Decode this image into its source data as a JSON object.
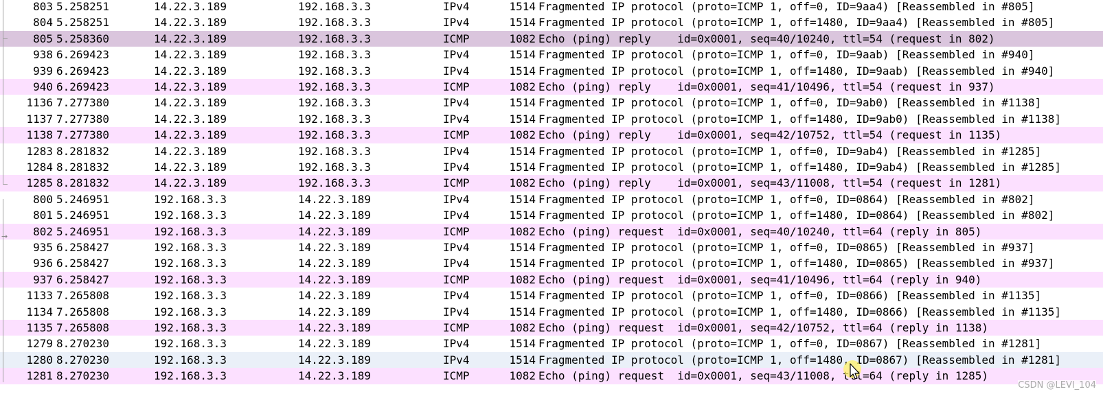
{
  "packet_list": {
    "rows": [
      {
        "no": "803",
        "time": "5.258251",
        "src": "14.22.3.189",
        "dst": "192.168.3.3",
        "proto": "IPv4",
        "len": "1514",
        "info": "Fragmented IP protocol (proto=ICMP 1, off=0, ID=9aa4) [Reassembled in #805]",
        "style": "ipv4"
      },
      {
        "no": "804",
        "time": "5.258251",
        "src": "14.22.3.189",
        "dst": "192.168.3.3",
        "proto": "IPv4",
        "len": "1514",
        "info": "Fragmented IP protocol (proto=ICMP 1, off=1480, ID=9aa4) [Reassembled in #805]",
        "style": "ipv4"
      },
      {
        "no": "805",
        "time": "5.258360",
        "src": "14.22.3.189",
        "dst": "192.168.3.3",
        "proto": "ICMP",
        "len": "1082",
        "info": "Echo (ping) reply    id=0x0001, seq=40/10240, ttl=54 (request in 802)",
        "style": "selected"
      },
      {
        "no": "938",
        "time": "6.269423",
        "src": "14.22.3.189",
        "dst": "192.168.3.3",
        "proto": "IPv4",
        "len": "1514",
        "info": "Fragmented IP protocol (proto=ICMP 1, off=0, ID=9aab) [Reassembled in #940]",
        "style": "ipv4"
      },
      {
        "no": "939",
        "time": "6.269423",
        "src": "14.22.3.189",
        "dst": "192.168.3.3",
        "proto": "IPv4",
        "len": "1514",
        "info": "Fragmented IP protocol (proto=ICMP 1, off=1480, ID=9aab) [Reassembled in #940]",
        "style": "ipv4"
      },
      {
        "no": "940",
        "time": "6.269423",
        "src": "14.22.3.189",
        "dst": "192.168.3.3",
        "proto": "ICMP",
        "len": "1082",
        "info": "Echo (ping) reply    id=0x0001, seq=41/10496, ttl=54 (request in 937)",
        "style": "icmp"
      },
      {
        "no": "1136",
        "time": "7.277380",
        "src": "14.22.3.189",
        "dst": "192.168.3.3",
        "proto": "IPv4",
        "len": "1514",
        "info": "Fragmented IP protocol (proto=ICMP 1, off=0, ID=9ab0) [Reassembled in #1138]",
        "style": "ipv4"
      },
      {
        "no": "1137",
        "time": "7.277380",
        "src": "14.22.3.189",
        "dst": "192.168.3.3",
        "proto": "IPv4",
        "len": "1514",
        "info": "Fragmented IP protocol (proto=ICMP 1, off=1480, ID=9ab0) [Reassembled in #1138]",
        "style": "ipv4"
      },
      {
        "no": "1138",
        "time": "7.277380",
        "src": "14.22.3.189",
        "dst": "192.168.3.3",
        "proto": "ICMP",
        "len": "1082",
        "info": "Echo (ping) reply    id=0x0001, seq=42/10752, ttl=54 (request in 1135)",
        "style": "icmp"
      },
      {
        "no": "1283",
        "time": "8.281832",
        "src": "14.22.3.189",
        "dst": "192.168.3.3",
        "proto": "IPv4",
        "len": "1514",
        "info": "Fragmented IP protocol (proto=ICMP 1, off=0, ID=9ab4) [Reassembled in #1285]",
        "style": "ipv4"
      },
      {
        "no": "1284",
        "time": "8.281832",
        "src": "14.22.3.189",
        "dst": "192.168.3.3",
        "proto": "IPv4",
        "len": "1514",
        "info": "Fragmented IP protocol (proto=ICMP 1, off=1480, ID=9ab4) [Reassembled in #1285]",
        "style": "ipv4"
      },
      {
        "no": "1285",
        "time": "8.281832",
        "src": "14.22.3.189",
        "dst": "192.168.3.3",
        "proto": "ICMP",
        "len": "1082",
        "info": "Echo (ping) reply    id=0x0001, seq=43/11008, ttl=54 (request in 1281)",
        "style": "icmp"
      },
      {
        "no": "800",
        "time": "5.246951",
        "src": "192.168.3.3",
        "dst": "14.22.3.189",
        "proto": "IPv4",
        "len": "1514",
        "info": "Fragmented IP protocol (proto=ICMP 1, off=0, ID=0864) [Reassembled in #802]",
        "style": "ipv4"
      },
      {
        "no": "801",
        "time": "5.246951",
        "src": "192.168.3.3",
        "dst": "14.22.3.189",
        "proto": "IPv4",
        "len": "1514",
        "info": "Fragmented IP protocol (proto=ICMP 1, off=1480, ID=0864) [Reassembled in #802]",
        "style": "ipv4"
      },
      {
        "no": "802",
        "time": "5.246951",
        "src": "192.168.3.3",
        "dst": "14.22.3.189",
        "proto": "ICMP",
        "len": "1082",
        "info": "Echo (ping) request  id=0x0001, seq=40/10240, ttl=64 (reply in 805)",
        "style": "icmp"
      },
      {
        "no": "935",
        "time": "6.258427",
        "src": "192.168.3.3",
        "dst": "14.22.3.189",
        "proto": "IPv4",
        "len": "1514",
        "info": "Fragmented IP protocol (proto=ICMP 1, off=0, ID=0865) [Reassembled in #937]",
        "style": "ipv4"
      },
      {
        "no": "936",
        "time": "6.258427",
        "src": "192.168.3.3",
        "dst": "14.22.3.189",
        "proto": "IPv4",
        "len": "1514",
        "info": "Fragmented IP protocol (proto=ICMP 1, off=1480, ID=0865) [Reassembled in #937]",
        "style": "ipv4"
      },
      {
        "no": "937",
        "time": "6.258427",
        "src": "192.168.3.3",
        "dst": "14.22.3.189",
        "proto": "ICMP",
        "len": "1082",
        "info": "Echo (ping) request  id=0x0001, seq=41/10496, ttl=64 (reply in 940)",
        "style": "icmp"
      },
      {
        "no": "1133",
        "time": "7.265808",
        "src": "192.168.3.3",
        "dst": "14.22.3.189",
        "proto": "IPv4",
        "len": "1514",
        "info": "Fragmented IP protocol (proto=ICMP 1, off=0, ID=0866) [Reassembled in #1135]",
        "style": "ipv4"
      },
      {
        "no": "1134",
        "time": "7.265808",
        "src": "192.168.3.3",
        "dst": "14.22.3.189",
        "proto": "IPv4",
        "len": "1514",
        "info": "Fragmented IP protocol (proto=ICMP 1, off=1480, ID=0866) [Reassembled in #1135]",
        "style": "ipv4"
      },
      {
        "no": "1135",
        "time": "7.265808",
        "src": "192.168.3.3",
        "dst": "14.22.3.189",
        "proto": "ICMP",
        "len": "1082",
        "info": "Echo (ping) request  id=0x0001, seq=42/10752, ttl=64 (reply in 1138)",
        "style": "icmp"
      },
      {
        "no": "1279",
        "time": "8.270230",
        "src": "192.168.3.3",
        "dst": "14.22.3.189",
        "proto": "IPv4",
        "len": "1514",
        "info": "Fragmented IP protocol (proto=ICMP 1, off=0, ID=0867) [Reassembled in #1281]",
        "style": "ipv4"
      },
      {
        "no": "1280",
        "time": "8.270230",
        "src": "192.168.3.3",
        "dst": "14.22.3.189",
        "proto": "IPv4",
        "len": "1514",
        "info": "Fragmented IP protocol (proto=ICMP 1, off=1480, ID=0867) [Reassembled in #1281]",
        "style": "hover"
      },
      {
        "no": "1281",
        "time": "8.270230",
        "src": "192.168.3.3",
        "dst": "14.22.3.189",
        "proto": "ICMP",
        "len": "1082",
        "info": "Echo (ping) request  id=0x0001, seq=43/11008, ttl=64 (reply in 1285)",
        "style": "icmp"
      }
    ]
  },
  "colors": {
    "icmp_row": "#fce0ff",
    "ipv4_row": "#ffffff",
    "selected_row": "#dac5dd",
    "hover_row": "#eaf0f8",
    "cursor_highlight": "#fff36a"
  },
  "watermark": {
    "text": "CSDN @LEVI_104"
  },
  "icons": {
    "cursor": "mouse-pointer-icon",
    "related_arrow": "related-packet-arrow-icon"
  }
}
